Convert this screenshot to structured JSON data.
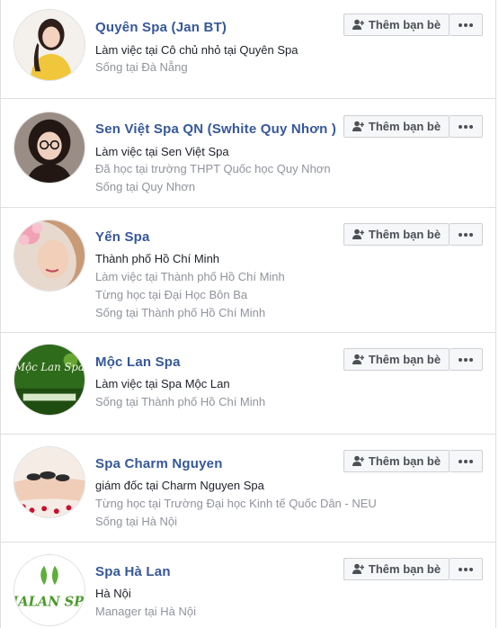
{
  "add_friend_label": "Thêm bạn bè",
  "more_label": "",
  "people": [
    {
      "name": "Quyên Spa (Jan BT)",
      "lines": [
        {
          "text": "Làm việc tại Cô chủ nhỏ tại Quyên Spa",
          "style": "dark"
        },
        {
          "text": "Sống tại Đà Nẵng",
          "style": "gray"
        }
      ],
      "avatar": "woman-yellow-dress-avatar"
    },
    {
      "name": "Sen Việt Spa QN (Swhite Quy Nhơn )",
      "lines": [
        {
          "text": "Làm việc tại Sen Việt Spa",
          "style": "dark"
        },
        {
          "text": "Đã học tại trường THPT Quốc học Quy Nhơn",
          "style": "gray"
        },
        {
          "text": "Sống tại Quy Nhơn",
          "style": "gray"
        }
      ],
      "avatar": "woman-glasses-avatar"
    },
    {
      "name": "Yến Spa",
      "lines": [
        {
          "text": "Thành phố Hồ Chí Minh",
          "style": "dark"
        },
        {
          "text": "Làm việc tại Thành phố Hồ Chí Minh",
          "style": "gray"
        },
        {
          "text": "Từng học tại Đại Học Bôn Ba",
          "style": "gray"
        },
        {
          "text": "Sống tại Thành phố Hồ Chí Minh",
          "style": "gray"
        }
      ],
      "avatar": "woman-flower-avatar"
    },
    {
      "name": "Mộc Lan Spa",
      "lines": [
        {
          "text": "Làm việc tại Spa Mộc Lan",
          "style": "dark"
        },
        {
          "text": "Sống tại Thành phố Hồ Chí Minh",
          "style": "gray"
        }
      ],
      "avatar": "moc-lan-spa-logo-avatar",
      "avatar_text": "Mộc Lan Spa"
    },
    {
      "name": "Spa Charm Nguyen",
      "lines": [
        {
          "text": "giám đốc tại Charm Nguyen Spa",
          "style": "dark"
        },
        {
          "text": "Từng học tại Trường Đại học Kinh tế Quốc Dân - NEU",
          "style": "gray"
        },
        {
          "text": "Sống tại Hà Nội",
          "style": "gray"
        }
      ],
      "avatar": "hot-stone-massage-avatar"
    },
    {
      "name": "Spa Hà Lan",
      "lines": [
        {
          "text": "Hà Nội",
          "style": "dark"
        },
        {
          "text": "Manager tại Hà Nội",
          "style": "gray"
        }
      ],
      "avatar": "ha-lan-spa-logo-avatar",
      "avatar_text": "HALAN SPA"
    }
  ],
  "colors": {
    "name_link": "#365899",
    "text_dark": "#1d2129",
    "text_gray": "#90949c",
    "button_bg": "#f6f7f9",
    "border": "#dddfe2"
  }
}
